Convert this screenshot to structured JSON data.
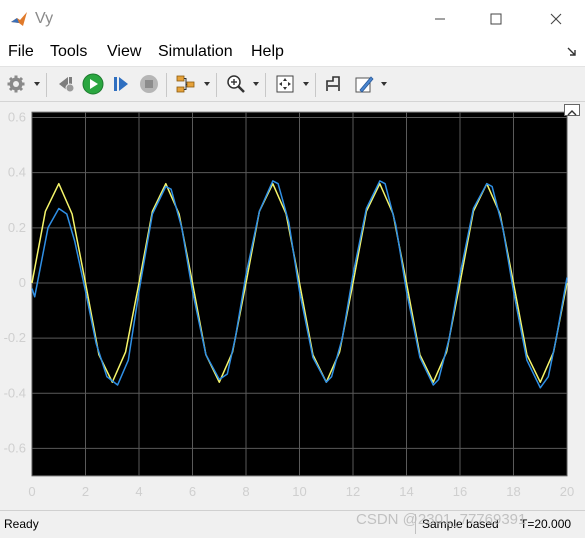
{
  "window": {
    "title": "Vy"
  },
  "menu": {
    "items": [
      "File",
      "Tools",
      "View",
      "Simulation",
      "Help"
    ]
  },
  "toolbar": {
    "icons": [
      "gear-icon",
      "step-back-icon",
      "run-icon",
      "step-forward-icon",
      "stop-icon",
      "highlight-block-icon",
      "zoom-in-icon",
      "fit-to-view-icon",
      "cursor-measure-icon",
      "style-icon"
    ]
  },
  "status": {
    "ready": "Ready",
    "mode": "Sample based",
    "time": "T=20.000"
  },
  "watermark": "CSDN @2301_77769391",
  "colors": {
    "plot_background": "#000000",
    "grid": "#5a5a5a",
    "axis_label": "#cfcfcf",
    "series_reference": "#f5f56a",
    "series_actual": "#2f8fe5",
    "run_button": "#2aa640"
  },
  "chart_data": {
    "type": "line",
    "title": "",
    "xlabel": "",
    "ylabel": "",
    "xlim": [
      0,
      20
    ],
    "ylim": [
      -0.7,
      0.62
    ],
    "xticks": [
      0,
      2,
      4,
      6,
      8,
      10,
      12,
      14,
      16,
      18,
      20
    ],
    "yticks": [
      -0.6,
      -0.4,
      -0.2,
      0,
      0.2,
      0.4,
      0.6
    ],
    "xtick_labels": [
      "0",
      "2",
      "4",
      "6",
      "8",
      "10",
      "12",
      "14",
      "16",
      "18",
      "20"
    ],
    "ytick_labels": [
      "-0.6",
      "-0.4",
      "-0.2",
      "0",
      "0.2",
      "0.4",
      "0.6"
    ],
    "grid": true,
    "series": [
      {
        "color": "#f5f56a",
        "x": [
          0,
          0.5,
          1.0,
          1.5,
          2.0,
          2.5,
          3.0,
          3.5,
          4.0,
          4.5,
          5.0,
          5.5,
          6.0,
          6.5,
          7.0,
          7.5,
          8.0,
          8.5,
          9.0,
          9.5,
          10.0,
          10.5,
          11.0,
          11.5,
          12.0,
          12.5,
          13.0,
          13.5,
          14.0,
          14.5,
          15.0,
          15.5,
          16.0,
          16.5,
          17.0,
          17.5,
          18.0,
          18.5,
          19.0,
          19.5,
          20.0
        ],
        "y": [
          0.0,
          0.26,
          0.36,
          0.25,
          0.0,
          -0.26,
          -0.36,
          -0.25,
          0.0,
          0.26,
          0.36,
          0.25,
          0.0,
          -0.26,
          -0.36,
          -0.25,
          0.0,
          0.26,
          0.36,
          0.25,
          0.0,
          -0.26,
          -0.36,
          -0.25,
          0.0,
          0.26,
          0.36,
          0.25,
          0.0,
          -0.26,
          -0.36,
          -0.25,
          0.0,
          0.26,
          0.36,
          0.25,
          0.0,
          -0.26,
          -0.36,
          -0.25,
          0.0
        ]
      },
      {
        "color": "#2f8fe5",
        "x": [
          0,
          0.1,
          0.3,
          0.6,
          1.0,
          1.3,
          1.6,
          2.0,
          2.4,
          2.8,
          3.2,
          3.6,
          4.0,
          4.5,
          5.0,
          5.2,
          5.6,
          6.0,
          6.5,
          7.0,
          7.3,
          7.6,
          8.0,
          8.5,
          9.0,
          9.2,
          9.6,
          10.0,
          10.5,
          11.0,
          11.2,
          11.6,
          12.0,
          12.5,
          13.0,
          13.2,
          13.6,
          14.0,
          14.5,
          15.0,
          15.2,
          15.6,
          16.0,
          16.5,
          17.0,
          17.2,
          17.6,
          18.0,
          18.5,
          19.0,
          19.3,
          19.6,
          20.0
        ],
        "y": [
          -0.02,
          -0.05,
          0.05,
          0.2,
          0.27,
          0.25,
          0.15,
          -0.03,
          -0.22,
          -0.34,
          -0.37,
          -0.28,
          -0.03,
          0.25,
          0.35,
          0.34,
          0.2,
          -0.03,
          -0.26,
          -0.35,
          -0.33,
          -0.2,
          0.03,
          0.26,
          0.37,
          0.36,
          0.22,
          -0.03,
          -0.27,
          -0.36,
          -0.34,
          -0.2,
          0.03,
          0.27,
          0.37,
          0.36,
          0.21,
          -0.03,
          -0.27,
          -0.37,
          -0.35,
          -0.2,
          0.03,
          0.27,
          0.36,
          0.35,
          0.2,
          -0.03,
          -0.28,
          -0.38,
          -0.34,
          -0.2,
          0.02
        ]
      }
    ]
  }
}
